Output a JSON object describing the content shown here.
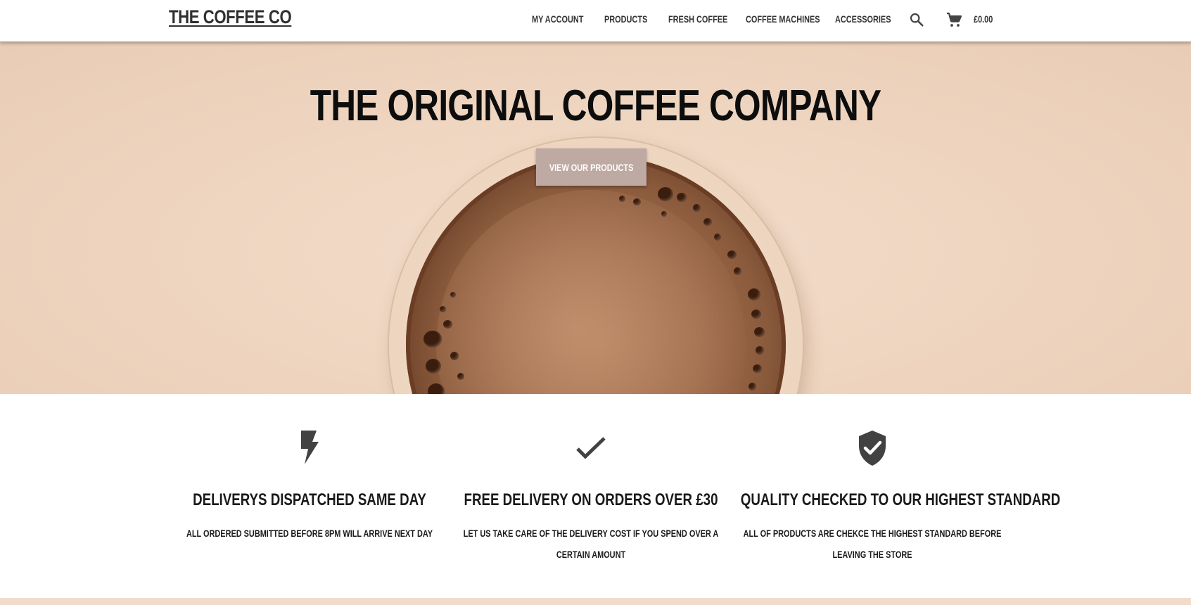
{
  "header": {
    "logo": "THE COFFEE CO",
    "nav": [
      {
        "label": "MY ACCOUNT"
      },
      {
        "label": "PRODUCTS"
      },
      {
        "label": "FRESH COFFEE"
      },
      {
        "label": "COFFEE MACHINES"
      },
      {
        "label": "ACCESSORIES"
      }
    ],
    "search_icon": "search-icon",
    "cart_icon": "shopping-cart-icon",
    "cart_total": "£0.00"
  },
  "hero": {
    "title": "THE ORIGINAL COFFEE COMPANY",
    "button_label": "VIEW OUR PRODUCTS"
  },
  "features": [
    {
      "icon": "lightning-bolt-icon",
      "title": "DELIVERYS DISPATCHED SAME DAY",
      "text": "ALL ORDERED SUBMITTED BEFORE 8PM WILL ARRIVE NEXT DAY"
    },
    {
      "icon": "checkmark-icon",
      "title": "FREE DELIVERY ON ORDERS OVER £30",
      "text": "LET US TAKE CARE OF THE DELIVERY COST IF YOU SPEND OVER A CERTAIN AMOUNT"
    },
    {
      "icon": "shield-check-icon",
      "title": "QUALITY CHECKED TO OUR HIGHEST STANDARD",
      "text": "ALL OF PRODUCTS ARE CHEKCE THE HIGHEST STANDARD BEFORE LEAVING THE STORE"
    }
  ],
  "colors": {
    "hero_background": "#efd6c1",
    "button_background": "#bfa9a3",
    "icon_color": "#424242",
    "text_color": "#1a1a1a"
  }
}
